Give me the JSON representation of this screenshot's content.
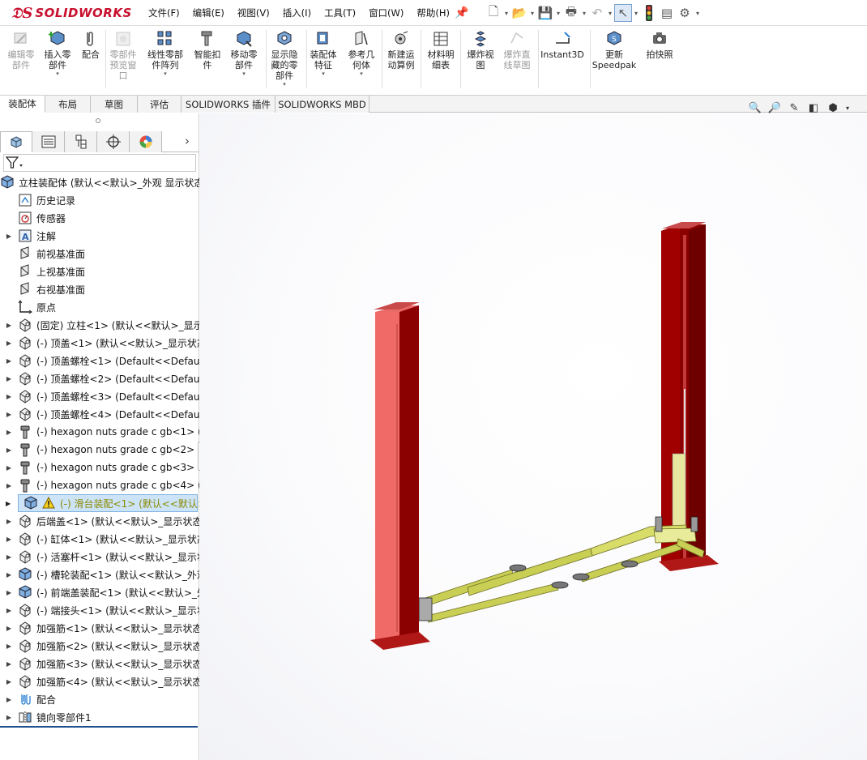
{
  "app": {
    "name": "SOLIDWORKS",
    "brand_color": "#c8102e"
  },
  "menu": [
    "文件(F)",
    "编辑(E)",
    "视图(V)",
    "插入(I)",
    "工具(T)",
    "窗口(W)",
    "帮助(H)"
  ],
  "quick_access": [
    "new-icon",
    "open-icon",
    "save-icon",
    "print-icon",
    "undo-icon",
    "select-icon",
    "rebuild-icon",
    "file-properties-icon",
    "options-icon"
  ],
  "ribbon": [
    {
      "label": "编辑零\n部件",
      "icon": "edit-component-icon",
      "disabled": true
    },
    {
      "label": "插入零\n部件",
      "icon": "insert-component-icon",
      "disabled": false
    },
    {
      "label": "配合",
      "icon": "mate-icon",
      "disabled": false
    },
    {
      "label": "零部件\n预览窗\n口",
      "icon": "component-preview-icon",
      "disabled": true
    },
    {
      "label": "线性零部\n件阵列",
      "icon": "linear-pattern-icon",
      "disabled": false
    },
    {
      "label": "智能扣\n件",
      "icon": "smart-fasteners-icon",
      "disabled": false
    },
    {
      "label": "移动零\n部件",
      "icon": "move-component-icon",
      "disabled": false
    },
    {
      "label": "显示隐\n藏的零\n部件",
      "icon": "show-hidden-icon",
      "disabled": false
    },
    {
      "label": "装配体\n特征",
      "icon": "assembly-features-icon",
      "disabled": false
    },
    {
      "label": "参考几\n何体",
      "icon": "reference-geometry-icon",
      "disabled": false
    },
    {
      "label": "新建运\n动算例",
      "icon": "motion-study-icon",
      "disabled": false
    },
    {
      "label": "材料明\n细表",
      "icon": "bom-icon",
      "disabled": false
    },
    {
      "label": "爆炸视\n图",
      "icon": "exploded-view-icon",
      "disabled": false
    },
    {
      "label": "爆炸直\n线草图",
      "icon": "explode-line-sketch-icon",
      "disabled": true
    },
    {
      "label": "Instant3D",
      "icon": "instant3d-icon",
      "disabled": false
    },
    {
      "label": "更新\nSpeedpak",
      "icon": "speedpak-icon",
      "disabled": false
    },
    {
      "label": "拍快照",
      "icon": "snapshot-icon",
      "disabled": false
    }
  ],
  "tabs": [
    "装配体",
    "布局",
    "草图",
    "评估",
    "SOLIDWORKS 插件",
    "SOLIDWORKS MBD"
  ],
  "tree": [
    {
      "text": "立柱装配体  (默认<<默认>_外观 显示状态",
      "icon": "assembly",
      "level": 0,
      "expand": ""
    },
    {
      "text": "历史记录",
      "icon": "history",
      "level": 1,
      "expand": ""
    },
    {
      "text": "传感器",
      "icon": "sensor",
      "level": 1,
      "expand": ""
    },
    {
      "text": "注解",
      "icon": "annotation",
      "level": 1,
      "expand": "▶"
    },
    {
      "text": "前视基准面",
      "icon": "plane",
      "level": 1,
      "expand": ""
    },
    {
      "text": "上视基准面",
      "icon": "plane",
      "level": 1,
      "expand": ""
    },
    {
      "text": "右视基准面",
      "icon": "plane",
      "level": 1,
      "expand": ""
    },
    {
      "text": "原点",
      "icon": "origin",
      "level": 1,
      "expand": ""
    },
    {
      "text": "(固定) 立柱<1> (默认<<默认>_显示状态",
      "icon": "part",
      "level": 1,
      "expand": "▶"
    },
    {
      "text": "(-) 顶盖<1> (默认<<默认>_显示状态",
      "icon": "part",
      "level": 1,
      "expand": "▶"
    },
    {
      "text": "(-) 顶盖螺栓<1> (Default<<Default>",
      "icon": "part",
      "level": 1,
      "expand": "▶"
    },
    {
      "text": "(-) 顶盖螺栓<2> (Default<<Default>",
      "icon": "part",
      "level": 1,
      "expand": "▶"
    },
    {
      "text": "(-) 顶盖螺栓<3> (Default<<Default>",
      "icon": "part",
      "level": 1,
      "expand": "▶"
    },
    {
      "text": "(-) 顶盖螺栓<4> (Default<<Default>",
      "icon": "part",
      "level": 1,
      "expand": "▶"
    },
    {
      "text": "(-) hexagon nuts grade c gb<1> (",
      "icon": "toolbox",
      "level": 1,
      "expand": "▶"
    },
    {
      "text": "(-) hexagon nuts grade c gb<2> (",
      "icon": "toolbox",
      "level": 1,
      "expand": "▶"
    },
    {
      "text": "(-) hexagon nuts grade c gb<3> (",
      "icon": "toolbox",
      "level": 1,
      "expand": "▶"
    },
    {
      "text": "(-) hexagon nuts grade c gb<4> (",
      "icon": "toolbox",
      "level": 1,
      "expand": "▶"
    },
    {
      "text": "(-) 滑台装配<1> (默认<<默认>_外观",
      "icon": "subassembly-warning",
      "level": 1,
      "expand": "▶",
      "selected": true
    },
    {
      "text": "后端盖<1> (默认<<默认>_显示状态",
      "icon": "part",
      "level": 1,
      "expand": "▶"
    },
    {
      "text": "(-) 缸体<1> (默认<<默认>_显示状态",
      "icon": "part",
      "level": 1,
      "expand": "▶"
    },
    {
      "text": "(-) 活塞杆<1> (默认<<默认>_显示状态",
      "icon": "part",
      "level": 1,
      "expand": "▶"
    },
    {
      "text": "(-) 槽轮装配<1> (默认<<默认>_外观",
      "icon": "subassembly",
      "level": 1,
      "expand": "▶"
    },
    {
      "text": "(-) 前端盖装配<1> (默认<<默认>_外观",
      "icon": "subassembly",
      "level": 1,
      "expand": "▶"
    },
    {
      "text": "(-) 端接头<1> (默认<<默认>_显示状态",
      "icon": "part",
      "level": 1,
      "expand": "▶"
    },
    {
      "text": "加强筋<1> (默认<<默认>_显示状态",
      "icon": "part",
      "level": 1,
      "expand": "▶"
    },
    {
      "text": "加强筋<2> (默认<<默认>_显示状态",
      "icon": "part",
      "level": 1,
      "expand": "▶"
    },
    {
      "text": "加强筋<3> (默认<<默认>_显示状态",
      "icon": "part",
      "level": 1,
      "expand": "▶"
    },
    {
      "text": "加强筋<4> (默认<<默认>_显示状态",
      "icon": "part",
      "level": 1,
      "expand": "▶"
    },
    {
      "text": "配合",
      "icon": "mates",
      "level": 1,
      "expand": "▶"
    },
    {
      "text": "镜向零部件1",
      "icon": "mirror",
      "level": 1,
      "expand": "▶"
    }
  ],
  "colors": {
    "column": "#9e0000",
    "column_light": "#e8605f",
    "arm": "#c9cf54",
    "selection": "#cde3f7"
  }
}
